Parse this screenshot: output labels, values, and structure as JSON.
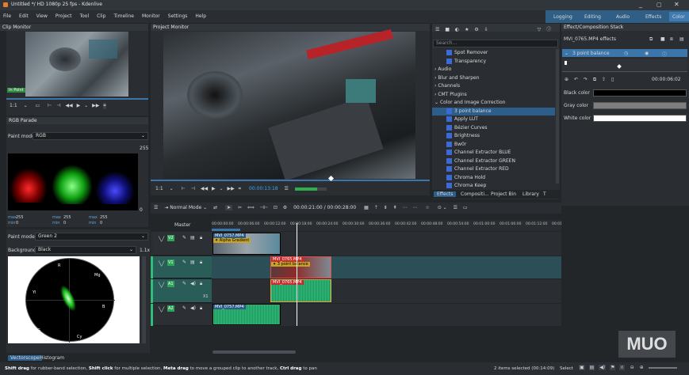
{
  "window": {
    "title": "Untitled */ HD 1080p 25 fps - Kdenlive",
    "controls": [
      "_",
      "▢",
      "✕"
    ]
  },
  "menu": [
    "File",
    "Edit",
    "View",
    "Project",
    "Tool",
    "Clip",
    "Timeline",
    "Monitor",
    "Settings",
    "Help"
  ],
  "workspaces": {
    "items": [
      "Logging",
      "Editing",
      "Audio",
      "Effects",
      "Color"
    ],
    "active": "Color"
  },
  "clip_monitor": {
    "title": "Clip Monitor",
    "badge": "In Point",
    "zoom": "1:1"
  },
  "project_monitor": {
    "title": "Project Monitor",
    "zoom": "1:1",
    "timecode": "00:00:13:18"
  },
  "rgb_parade": {
    "title": "RGB Parade",
    "paint_mode_label": "Paint mode:",
    "paint_mode": "RGB",
    "scale_top": "255",
    "scale_bottom": "0",
    "stats": [
      {
        "k1": "max",
        "v1": "255",
        "k2": "max",
        "v2": "255",
        "k3": "max",
        "v3": "255"
      },
      {
        "k1": "min",
        "v1": "0",
        "k2": "min",
        "v2": "0",
        "k3": "min",
        "v3": "0"
      }
    ]
  },
  "vectorscope": {
    "paint_mode_label": "Paint mode:",
    "paint_mode": "Green 2",
    "background_label": "Background:",
    "background": "Black",
    "zoom": "1.1x",
    "markers": [
      "R",
      "Mg",
      "B",
      "Yl",
      "G",
      "Cy"
    ],
    "tabs": [
      "Vectorscope",
      "Histogram"
    ]
  },
  "effects_list": {
    "search_placeholder": "Search...",
    "items": [
      {
        "label": "Spot Remover",
        "indent": 2
      },
      {
        "label": "Transparency",
        "indent": 2
      },
      {
        "label": "Audio",
        "indent": 0
      },
      {
        "label": "Blur and Sharpen",
        "indent": 0
      },
      {
        "label": "Channels",
        "indent": 0
      },
      {
        "label": "CMT Plugins",
        "indent": 0
      },
      {
        "label": "Color and Image Correction",
        "indent": 0,
        "open": true
      },
      {
        "label": "3 point balance",
        "indent": 2,
        "selected": true
      },
      {
        "label": "Apply LUT",
        "indent": 2
      },
      {
        "label": "Bézier Curves",
        "indent": 2
      },
      {
        "label": "Brightness",
        "indent": 2
      },
      {
        "label": "Bw0r",
        "indent": 2
      },
      {
        "label": "Channel Extractor BLUE",
        "indent": 2
      },
      {
        "label": "Channel Extractor GREEN",
        "indent": 2
      },
      {
        "label": "Channel Extractor RED",
        "indent": 2
      },
      {
        "label": "Chroma Hold",
        "indent": 2
      },
      {
        "label": "Chroma Keep",
        "indent": 2
      }
    ],
    "tabs": [
      "Effects",
      "Compositi...",
      "Project Bin",
      "Library",
      "T"
    ]
  },
  "effect_stack": {
    "title": "Effect/Composition Stack",
    "clip_label": "MVI_0765.MP4 effects",
    "effect_name": "3 point balance",
    "timecode": "00:00:06:02",
    "params": [
      {
        "label": "Black color",
        "color": "#000000"
      },
      {
        "label": "Gray color",
        "color": "#7f7f7f"
      },
      {
        "label": "White color",
        "color": "#ffffff"
      }
    ]
  },
  "timeline": {
    "edit_mode": "Normal Mode",
    "position": "00:00:21:00",
    "duration": "00:00:28:00",
    "master": "Master",
    "ruler": [
      "00:00:00:00",
      "00:00:06:00",
      "00:00:12:00",
      "00:00:18:00",
      "00:00:24:00",
      "00:00:30:00",
      "00:00:36:00",
      "00:00:42:00",
      "00:00:48:00",
      "00:00:54:00",
      "00:01:00:00",
      "00:01:06:00",
      "00:01:12:00",
      "00:01:1"
    ],
    "tracks": [
      {
        "name": "V2",
        "type": "video"
      },
      {
        "name": "V1",
        "type": "video"
      },
      {
        "name": "A1",
        "type": "audio",
        "extra": "X1"
      },
      {
        "name": "A2",
        "type": "audio"
      }
    ],
    "clips": {
      "v2": {
        "name": "MVI_0757.MP4",
        "effect": "Alpha Gradient"
      },
      "v1": {
        "name": "MVI_0765.MP4",
        "effect": "3 point balance"
      },
      "a1": {
        "name": "MVI_0765.MP4"
      },
      "a2": {
        "name": "MVI_0757.MP4"
      }
    }
  },
  "status": {
    "hint_parts": [
      {
        "b": "Shift drag",
        "t": " for rubber-band selection, "
      },
      {
        "b": "Shift click",
        "t": " for multiple selection, "
      },
      {
        "b": "Meta drag",
        "t": " to move a grouped clip to another track, "
      },
      {
        "b": "Ctrl drag",
        "t": " to pan"
      }
    ],
    "selection": "2 items selected (00:14:09)",
    "mode": "Select"
  },
  "watermark": "MUO"
}
